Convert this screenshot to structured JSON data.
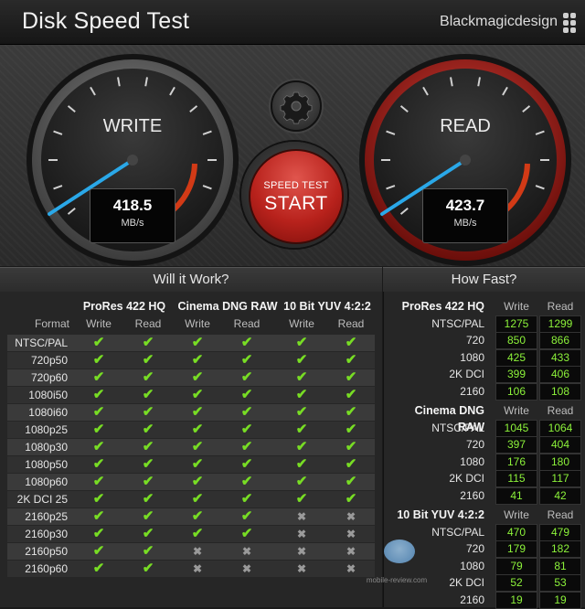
{
  "app": {
    "title": "Disk Speed Test",
    "brand": "Blackmagicdesign"
  },
  "gauges": {
    "write": {
      "label": "WRITE",
      "value": "418.5",
      "unit": "MB/s"
    },
    "read": {
      "label": "READ",
      "value": "423.7",
      "unit": "MB/s"
    }
  },
  "start_button": {
    "small": "SPEED TEST",
    "big": "START"
  },
  "settings_icon": "gear-icon",
  "sections": {
    "will_it_work": "Will it Work?",
    "how_fast": "How Fast?"
  },
  "will_it_work": {
    "format_header": "Format",
    "groups": [
      "ProRes 422 HQ",
      "Cinema DNG RAW",
      "10 Bit YUV 4:2:2"
    ],
    "sub_write": "Write",
    "sub_read": "Read",
    "rows": [
      {
        "format": "NTSC/PAL",
        "checks": [
          1,
          1,
          1,
          1,
          1,
          1
        ]
      },
      {
        "format": "720p50",
        "checks": [
          1,
          1,
          1,
          1,
          1,
          1
        ]
      },
      {
        "format": "720p60",
        "checks": [
          1,
          1,
          1,
          1,
          1,
          1
        ]
      },
      {
        "format": "1080i50",
        "checks": [
          1,
          1,
          1,
          1,
          1,
          1
        ]
      },
      {
        "format": "1080i60",
        "checks": [
          1,
          1,
          1,
          1,
          1,
          1
        ]
      },
      {
        "format": "1080p25",
        "checks": [
          1,
          1,
          1,
          1,
          1,
          1
        ]
      },
      {
        "format": "1080p30",
        "checks": [
          1,
          1,
          1,
          1,
          1,
          1
        ]
      },
      {
        "format": "1080p50",
        "checks": [
          1,
          1,
          1,
          1,
          1,
          1
        ]
      },
      {
        "format": "1080p60",
        "checks": [
          1,
          1,
          1,
          1,
          1,
          1
        ]
      },
      {
        "format": "2K DCI 25",
        "checks": [
          1,
          1,
          1,
          1,
          1,
          1
        ]
      },
      {
        "format": "2160p25",
        "checks": [
          1,
          1,
          1,
          1,
          0,
          0
        ]
      },
      {
        "format": "2160p30",
        "checks": [
          1,
          1,
          1,
          1,
          0,
          0
        ]
      },
      {
        "format": "2160p50",
        "checks": [
          1,
          1,
          0,
          0,
          0,
          0
        ]
      },
      {
        "format": "2160p60",
        "checks": [
          1,
          1,
          0,
          0,
          0,
          0
        ]
      }
    ]
  },
  "how_fast": {
    "write_label": "Write",
    "read_label": "Read",
    "groups": [
      {
        "name": "ProRes 422 HQ",
        "rows": [
          {
            "res": "NTSC/PAL",
            "write": "1275",
            "read": "1299"
          },
          {
            "res": "720",
            "write": "850",
            "read": "866"
          },
          {
            "res": "1080",
            "write": "425",
            "read": "433"
          },
          {
            "res": "2K DCI",
            "write": "399",
            "read": "406"
          },
          {
            "res": "2160",
            "write": "106",
            "read": "108"
          }
        ]
      },
      {
        "name": "Cinema DNG RAW",
        "rows": [
          {
            "res": "NTSC/PAL",
            "write": "1045",
            "read": "1064"
          },
          {
            "res": "720",
            "write": "397",
            "read": "404"
          },
          {
            "res": "1080",
            "write": "176",
            "read": "180"
          },
          {
            "res": "2K DCI",
            "write": "115",
            "read": "117"
          },
          {
            "res": "2160",
            "write": "41",
            "read": "42"
          }
        ]
      },
      {
        "name": "10 Bit YUV 4:2:2",
        "rows": [
          {
            "res": "NTSC/PAL",
            "write": "470",
            "read": "479"
          },
          {
            "res": "720",
            "write": "179",
            "read": "182"
          },
          {
            "res": "1080",
            "write": "79",
            "read": "81"
          },
          {
            "res": "2K DCI",
            "write": "52",
            "read": "53"
          },
          {
            "res": "2160",
            "write": "19",
            "read": "19"
          }
        ]
      }
    ]
  },
  "watermark": "mobile-review.com",
  "colors": {
    "check": "#78dd24",
    "value": "#8cf23a",
    "needle": "#2aa8e8",
    "read_ring": "#c0201a",
    "start": "#c8281f"
  }
}
